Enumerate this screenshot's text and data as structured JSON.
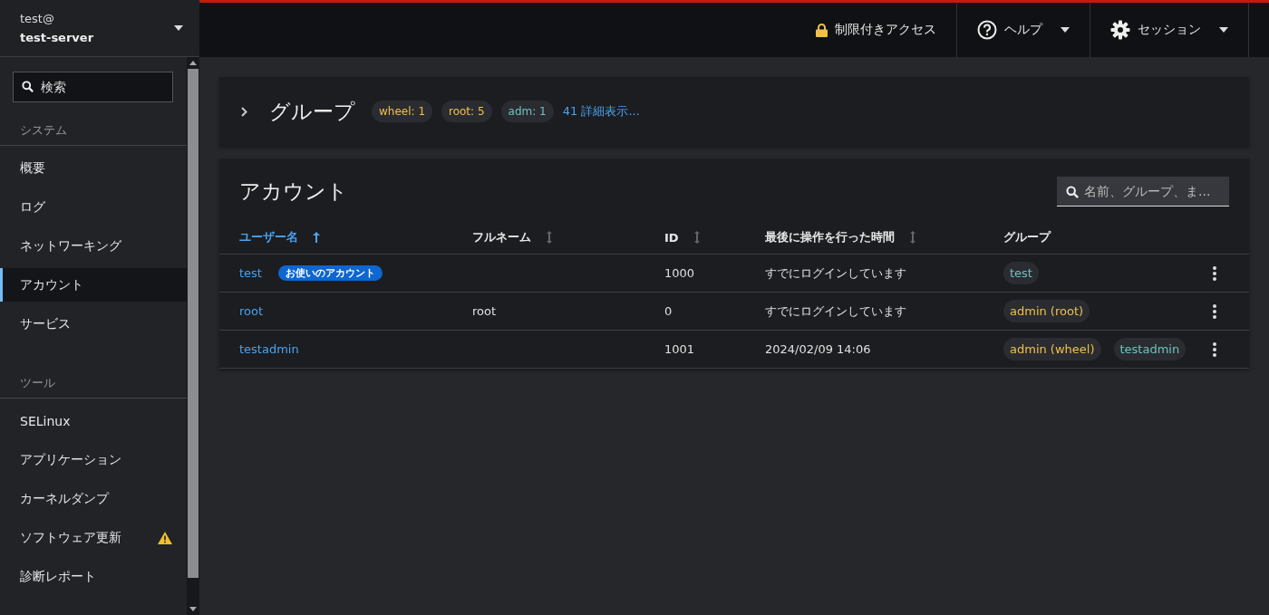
{
  "host": {
    "user": "test@",
    "server": "test-server"
  },
  "sidebar": {
    "search": {
      "placeholder": "検索"
    },
    "sections": [
      {
        "title": "システム",
        "items": [
          {
            "label": "概要",
            "selected": false,
            "warning": false
          },
          {
            "label": "ログ",
            "selected": false,
            "warning": false
          },
          {
            "label": "ネットワーキング",
            "selected": false,
            "warning": false
          },
          {
            "label": "アカウント",
            "selected": true,
            "warning": false
          },
          {
            "label": "サービス",
            "selected": false,
            "warning": false
          }
        ]
      },
      {
        "title": "ツール",
        "items": [
          {
            "label": "SELinux",
            "selected": false,
            "warning": false
          },
          {
            "label": "アプリケーション",
            "selected": false,
            "warning": false
          },
          {
            "label": "カーネルダンプ",
            "selected": false,
            "warning": false
          },
          {
            "label": "ソフトウェア更新",
            "selected": false,
            "warning": true
          },
          {
            "label": "診断レポート",
            "selected": false,
            "warning": false
          }
        ]
      }
    ]
  },
  "topbar": {
    "access": "制限付きアクセス",
    "help": "ヘルプ",
    "session": "セッション"
  },
  "groups": {
    "title": "グループ",
    "expanded": false,
    "chips": [
      {
        "label": "wheel: 1",
        "color": "#f0c04a"
      },
      {
        "label": "root: 5",
        "color": "#f0c04a"
      },
      {
        "label": "adm: 1",
        "color": "#6ec3be"
      }
    ],
    "more": "41 詳細表示..."
  },
  "accounts": {
    "title": "アカウント",
    "search": {
      "placeholder": "名前、グループ、ま..."
    },
    "columns": [
      {
        "label": "ユーザー名",
        "sortable": true,
        "sorted": true
      },
      {
        "label": "フルネーム",
        "sortable": true,
        "sorted": false
      },
      {
        "label": "ID",
        "sortable": true,
        "sorted": false
      },
      {
        "label": "最後に操作を行った時間",
        "sortable": true,
        "sorted": false
      },
      {
        "label": "グループ",
        "sortable": false,
        "sorted": false
      }
    ],
    "rows": [
      {
        "username": "test",
        "badge": "お使いのアカウント",
        "id": "1000",
        "last": "すでにログインしています",
        "groups": [
          {
            "label": "test",
            "color": "#6ec3be"
          }
        ]
      },
      {
        "username": "root",
        "fullname": "root",
        "id": "0",
        "last": "すでにログインしています",
        "groups": [
          {
            "label": "admin (root)",
            "color": "#f0c04a"
          }
        ]
      },
      {
        "username": "testadmin",
        "id": "1001",
        "last": "2024/02/09 14:06",
        "groups": [
          {
            "label": "admin (wheel)",
            "color": "#f0c04a"
          },
          {
            "label": "testadmin",
            "color": "#6ec3be"
          }
        ]
      }
    ]
  }
}
